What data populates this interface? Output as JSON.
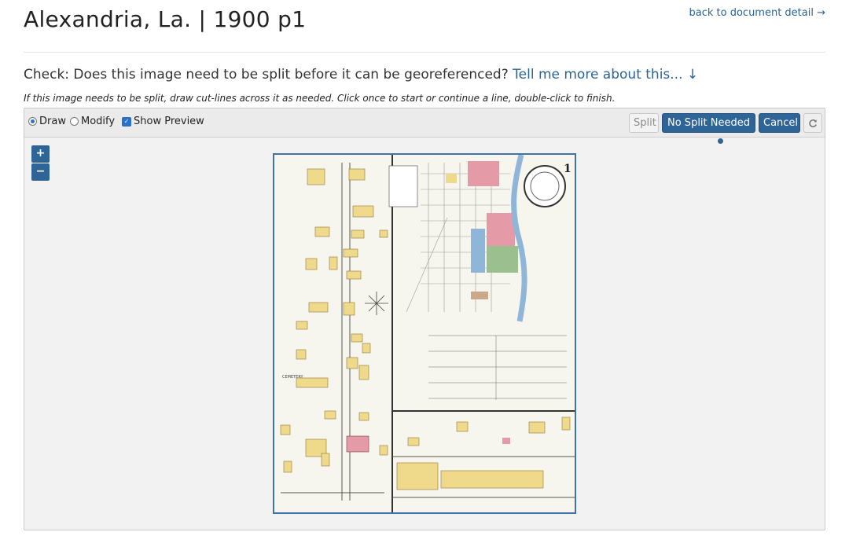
{
  "page": {
    "title": "Alexandria, La. | 1900 p1",
    "back_link": "back to document detail →"
  },
  "check": {
    "question": "Check: Does this image need to be split before it can be georeferenced?",
    "more_link": "Tell me more about this... ↓",
    "hint": "If this image needs to be split, draw cut-lines across it as needed. Click once to start or continue a line, double-click to finish."
  },
  "toolbar": {
    "draw_label": "Draw",
    "modify_label": "Modify",
    "show_preview_label": "Show Preview",
    "mode_selected": "Draw",
    "show_preview_checked": true,
    "split_label": "Split",
    "no_split_label": "No Split Needed",
    "cancel_label": "Cancel",
    "refresh_icon": "refresh-icon"
  },
  "map": {
    "zoom_in_label": "+",
    "zoom_out_label": "−",
    "sheet_number": "1",
    "cemetery_label": "CEMETERY",
    "colors": {
      "yellow": "#efd98a",
      "pink": "#e59aa8",
      "blue": "#8fb6d8",
      "green": "#9cbf8f",
      "border": "#3d72aa",
      "button": "#2f6497"
    }
  }
}
